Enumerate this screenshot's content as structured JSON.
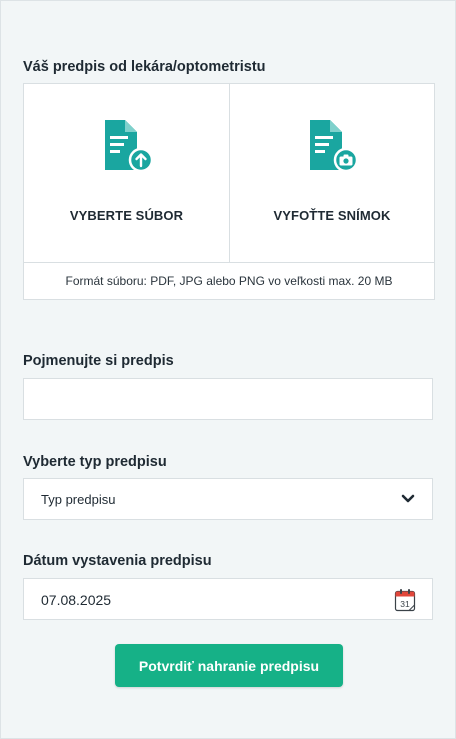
{
  "upload": {
    "label": "Váš predpis od lekára/optometristu",
    "choose_file": "VYBERTE SÚBOR",
    "take_photo": "VYFOŤTE SNÍMOK",
    "format_note": "Formát súboru: PDF, JPG alebo PNG vo veľkosti max. 20 MB"
  },
  "name_field": {
    "label": "Pojmenujte si predpis",
    "value": "",
    "placeholder": ""
  },
  "type_field": {
    "label": "Vyberte typ predpisu",
    "selected": "Typ predpisu"
  },
  "date_field": {
    "label": "Dátum vystavenia predpisu",
    "value": "07.08.2025",
    "calendar_day": "31"
  },
  "confirm_button": "Potvrdiť nahranie predpisu",
  "colors": {
    "accent": "#16b187",
    "icon_teal": "#1aa6a0",
    "calendar_red": "#e0463a"
  },
  "icons": [
    "document-upload-icon",
    "document-camera-icon",
    "chevron-down-icon",
    "calendar-icon"
  ]
}
